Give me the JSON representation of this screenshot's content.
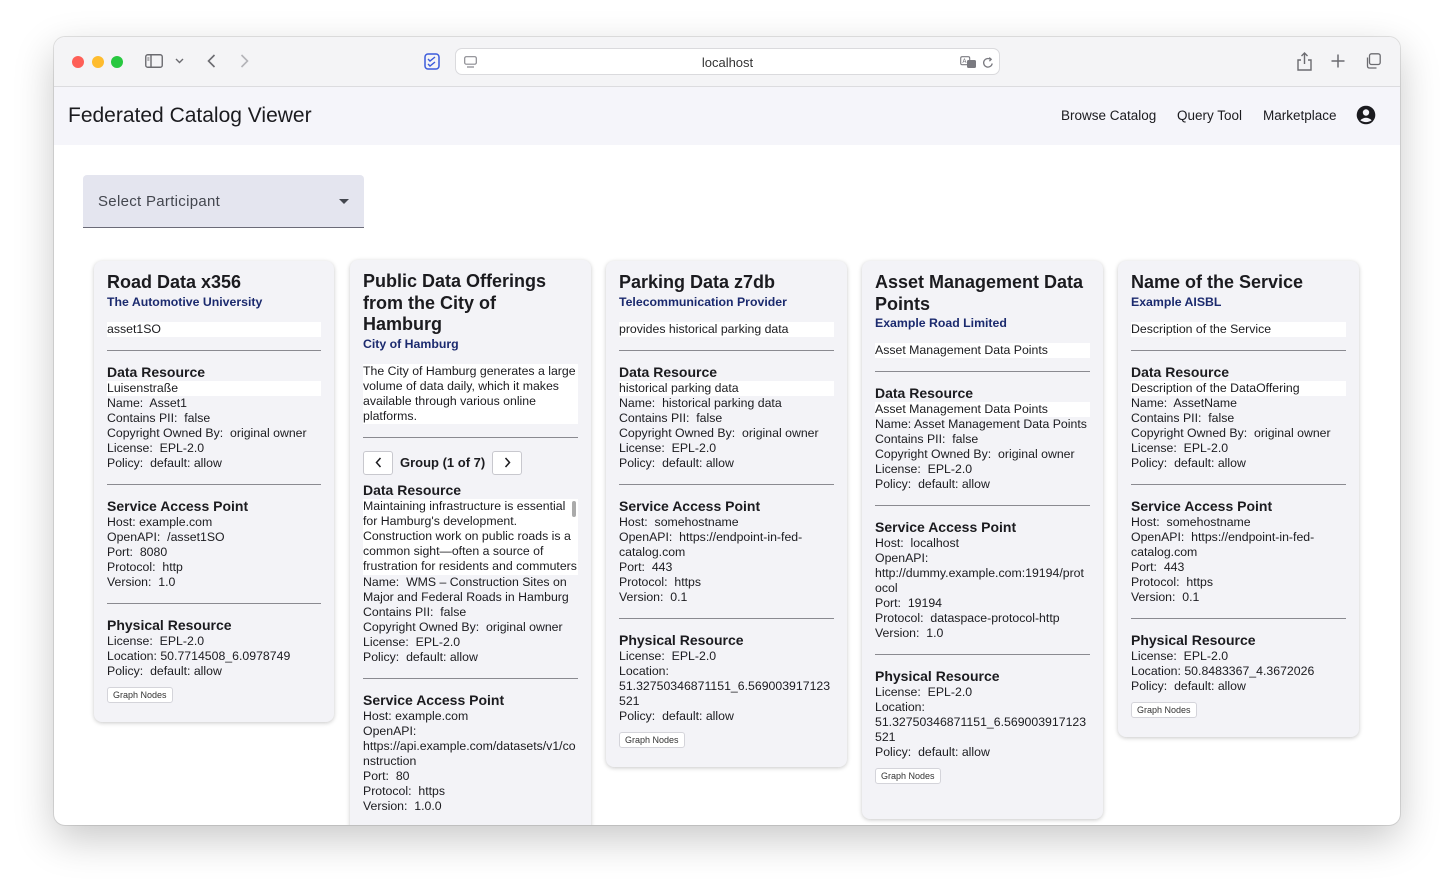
{
  "browser": {
    "url": "localhost",
    "icons": [
      "close-dot",
      "minimize-dot",
      "maximize-dot",
      "sidebar-icon",
      "chevron-down-icon",
      "back-icon",
      "forward-icon",
      "extension-icon",
      "page-icon",
      "translate-icon",
      "reload-icon",
      "share-icon",
      "new-tab-icon",
      "tabs-overview-icon"
    ]
  },
  "app": {
    "title": "Federated Catalog Viewer",
    "nav": [
      "Browse Catalog",
      "Query Tool",
      "Marketplace"
    ],
    "account_icon": "account-circle-icon"
  },
  "filter": {
    "select_label": "Select Participant"
  },
  "labels": {
    "name": "Name:",
    "pii": "Contains PII:",
    "copyright": "Copyright Owned By:",
    "license": "License:",
    "policy": "Policy:",
    "host": "Host:",
    "openapi": "OpenAPI:",
    "port": "Port:",
    "protocol": "Protocol:",
    "version": "Version:",
    "location": "Location:",
    "data_resource": "Data Resource",
    "service_access_point": "Service Access Point",
    "physical_resource": "Physical Resource",
    "graph_nodes": "Graph Nodes"
  },
  "cards": [
    {
      "title": "Road Data x356",
      "provider": "The Automotive University",
      "description": "asset1SO",
      "data_resource": {
        "desc": "Luisenstraße",
        "name": "Asset1",
        "pii": "false",
        "copyright": "original owner",
        "license": "EPL-2.0",
        "policy": "default: allow"
      },
      "sap": {
        "host": "example.com",
        "openapi": "/asset1SO",
        "port": "8080",
        "protocol": "http",
        "version": "1.0"
      },
      "physical": {
        "license": "EPL-2.0",
        "location": "50.7714508_6.0978749",
        "policy": "default: allow"
      }
    },
    {
      "title": "Public Data Offerings from the City of Hamburg",
      "provider": "City of Hamburg",
      "description": "The City of Hamburg generates a large volume of data daily, which it makes available through various online platforms.",
      "group": "Group (1 of 7)",
      "data_resource": {
        "desc": "Maintaining infrastructure is essential for Hamburg's development. Construction work on public roads is a common sight—often a source of frustration for residents and commuters alike.",
        "name": "WMS – Construction Sites on Major and Federal Roads in Hamburg",
        "pii": "false",
        "copyright": "original owner",
        "license": "EPL-2.0",
        "policy": "default: allow"
      },
      "sap": {
        "host": "example.com",
        "openapi": "https://api.example.com/datasets/v1/construction",
        "port": "80",
        "protocol": "https",
        "version": "1.0.0"
      }
    },
    {
      "title": "Parking Data z7db",
      "provider": "Telecommunication Provider",
      "description": "provides historical parking data",
      "data_resource": {
        "desc": "historical parking data",
        "name": "historical parking data",
        "pii": "false",
        "copyright": "original owner",
        "license": "EPL-2.0",
        "policy": "default: allow"
      },
      "sap": {
        "host": "somehostname",
        "openapi": "https://endpoint-in-fed-catalog.com",
        "port": "443",
        "protocol": "https",
        "version": "0.1"
      },
      "physical": {
        "license": "EPL-2.0",
        "location": "51.32750346871151_6.569003917123521",
        "policy": "default: allow"
      }
    },
    {
      "title": "Asset Management Data Points",
      "provider": "Example Road Limited",
      "description": "Asset Management Data Points",
      "data_resource": {
        "desc": "Asset Management Data Points",
        "name": "Asset Management Data Points",
        "pii": "false",
        "copyright": "original owner",
        "license": "EPL-2.0",
        "policy": "default: allow"
      },
      "sap": {
        "host": "localhost",
        "openapi": "http://dummy.example.com:19194/protocol",
        "port": "19194",
        "protocol": "dataspace-protocol-http",
        "version": "1.0"
      },
      "physical": {
        "license": "EPL-2.0",
        "location": "51.32750346871151_6.569003917123521",
        "policy": "default: allow"
      }
    },
    {
      "title": "Name of the Service",
      "provider": "Example AISBL",
      "description": "Description of the Service",
      "data_resource": {
        "desc": "Description of the DataOffering",
        "name": "AssetName",
        "pii": "false",
        "copyright": "original owner",
        "license": "EPL-2.0",
        "policy": "default: allow"
      },
      "sap": {
        "host": "somehostname",
        "openapi": "https://endpoint-in-fed-catalog.com",
        "port": "443",
        "protocol": "https",
        "version": "0.1"
      },
      "physical": {
        "license": "EPL-2.0",
        "location": "50.8483367_4.3672026",
        "policy": "default: allow"
      }
    }
  ]
}
